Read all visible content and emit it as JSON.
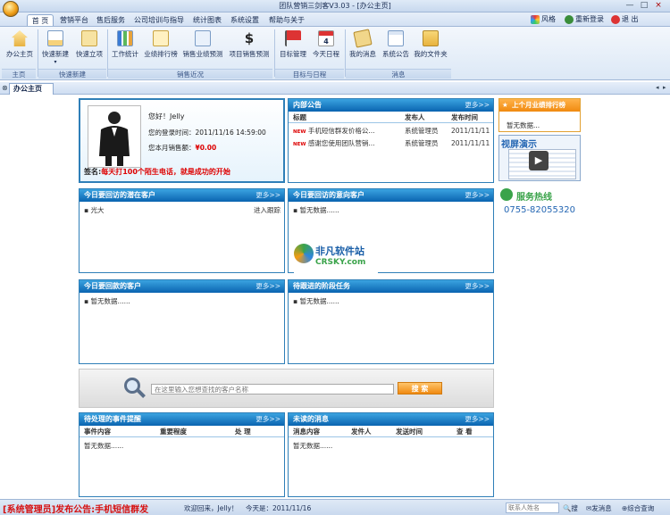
{
  "window": {
    "title": "团队营销三剑客V3.03 - [办公主页]",
    "controls": [
      "—",
      "□",
      "×"
    ]
  },
  "menu": {
    "tabs": [
      "首 页",
      "营销平台",
      "售后服务",
      "公司培训与指导",
      "统计图表",
      "系统设置",
      "帮助与关于"
    ],
    "right_tools": [
      {
        "icon": "palette-icon",
        "label": "风格"
      },
      {
        "icon": "relogin-icon",
        "label": "重新登录"
      },
      {
        "icon": "exit-icon",
        "label": "退 出"
      }
    ]
  },
  "ribbon": {
    "groups": [
      {
        "label": "主页",
        "buttons": [
          {
            "label": "办公主页",
            "icon": "home-icon"
          }
        ]
      },
      {
        "label": "快速新建",
        "buttons": [
          {
            "label": "快速新建",
            "icon": "new-doc-icon"
          },
          {
            "label": "快速立项",
            "icon": "project-icon"
          }
        ]
      },
      {
        "label": "销售近况",
        "buttons": [
          {
            "label": "工作统计",
            "icon": "bar-chart-icon"
          },
          {
            "label": "业绩排行榜",
            "icon": "ranking-icon"
          },
          {
            "label": "销售业绩预测",
            "icon": "forecast-icon"
          },
          {
            "label": "项目销售预测",
            "icon": "dollar-icon"
          }
        ]
      },
      {
        "label": "目标与日程",
        "buttons": [
          {
            "label": "目标管理",
            "icon": "flag-icon"
          },
          {
            "label": "今天日程",
            "icon": "calendar-icon"
          }
        ]
      },
      {
        "label": "消息",
        "buttons": [
          {
            "label": "我的消息",
            "icon": "message-icon"
          },
          {
            "label": "系统公告",
            "icon": "notice-icon"
          },
          {
            "label": "我的文件夹",
            "icon": "folder-icon"
          }
        ]
      }
    ]
  },
  "doc_tab": {
    "label": "办公主页"
  },
  "profile": {
    "greeting": "您好！Jelly",
    "login_label": "您的登录时间：",
    "login_time": "2011/11/16 14:59:00",
    "sales_label": "您本月销售额：",
    "sales_value": "¥0.00",
    "signature_label": "签名:",
    "signature": "每天打100个陌生电话，就是成功的开始"
  },
  "notices": {
    "title": "内部公告",
    "more": "更多>>",
    "columns": [
      "标题",
      "发布人",
      "发布时间"
    ],
    "rows": [
      {
        "badge": "NEW",
        "title": "手机短信群发价格公...",
        "author": "系统管理员",
        "date": "2011/11/11"
      },
      {
        "badge": "NEW",
        "title": "感谢您使用团队营销...",
        "author": "系统管理员",
        "date": "2011/11/11"
      }
    ]
  },
  "side": {
    "rank_title": "上个月业绩排行榜",
    "rank_empty": "暂无数据...",
    "demo_label": "视屏演示",
    "hotline_label": "服务热线",
    "hotline_number": "0755-82055320"
  },
  "followup_customers": {
    "title": "今日要回访的潜在客户",
    "more": "更多>>",
    "rows": [
      {
        "name": "光大",
        "action": "进入跟踪"
      }
    ]
  },
  "intent_customers": {
    "title": "今日要回访的意向客户",
    "more": "更多>>",
    "empty": "暂无数据......"
  },
  "watermark": {
    "brand": "非凡软件站",
    "sub": "CRSKY.com"
  },
  "payment_customers": {
    "title": "今日要回款的客户",
    "more": "更多>>",
    "empty": "暂无数据......"
  },
  "stage_tasks": {
    "title": "待跟进的阶段任务",
    "more": "更多>>",
    "empty": "暂无数据......"
  },
  "search": {
    "placeholder": "在这里输入您想查找的客户名称",
    "button": "搜 索"
  },
  "events": {
    "title": "待处理的事件提醒",
    "more": "更多>>",
    "columns": [
      "事件内容",
      "重要程度",
      "处 理"
    ],
    "empty": "暂无数据......"
  },
  "unread": {
    "title": "未读的消息",
    "more": "更多>>",
    "columns": [
      "消息内容",
      "发件人",
      "发送时间",
      "查 看"
    ],
    "empty": "暂无数据......"
  },
  "status": {
    "marquee": "[系统管理员]发布公告:手机短信群发",
    "welcome": "欢迎回来，Jelly！",
    "today": "今天是：2011/11/16",
    "contact_placeholder": "联系人姓名",
    "actions": [
      "搜",
      "发消息",
      "综合查询"
    ]
  }
}
